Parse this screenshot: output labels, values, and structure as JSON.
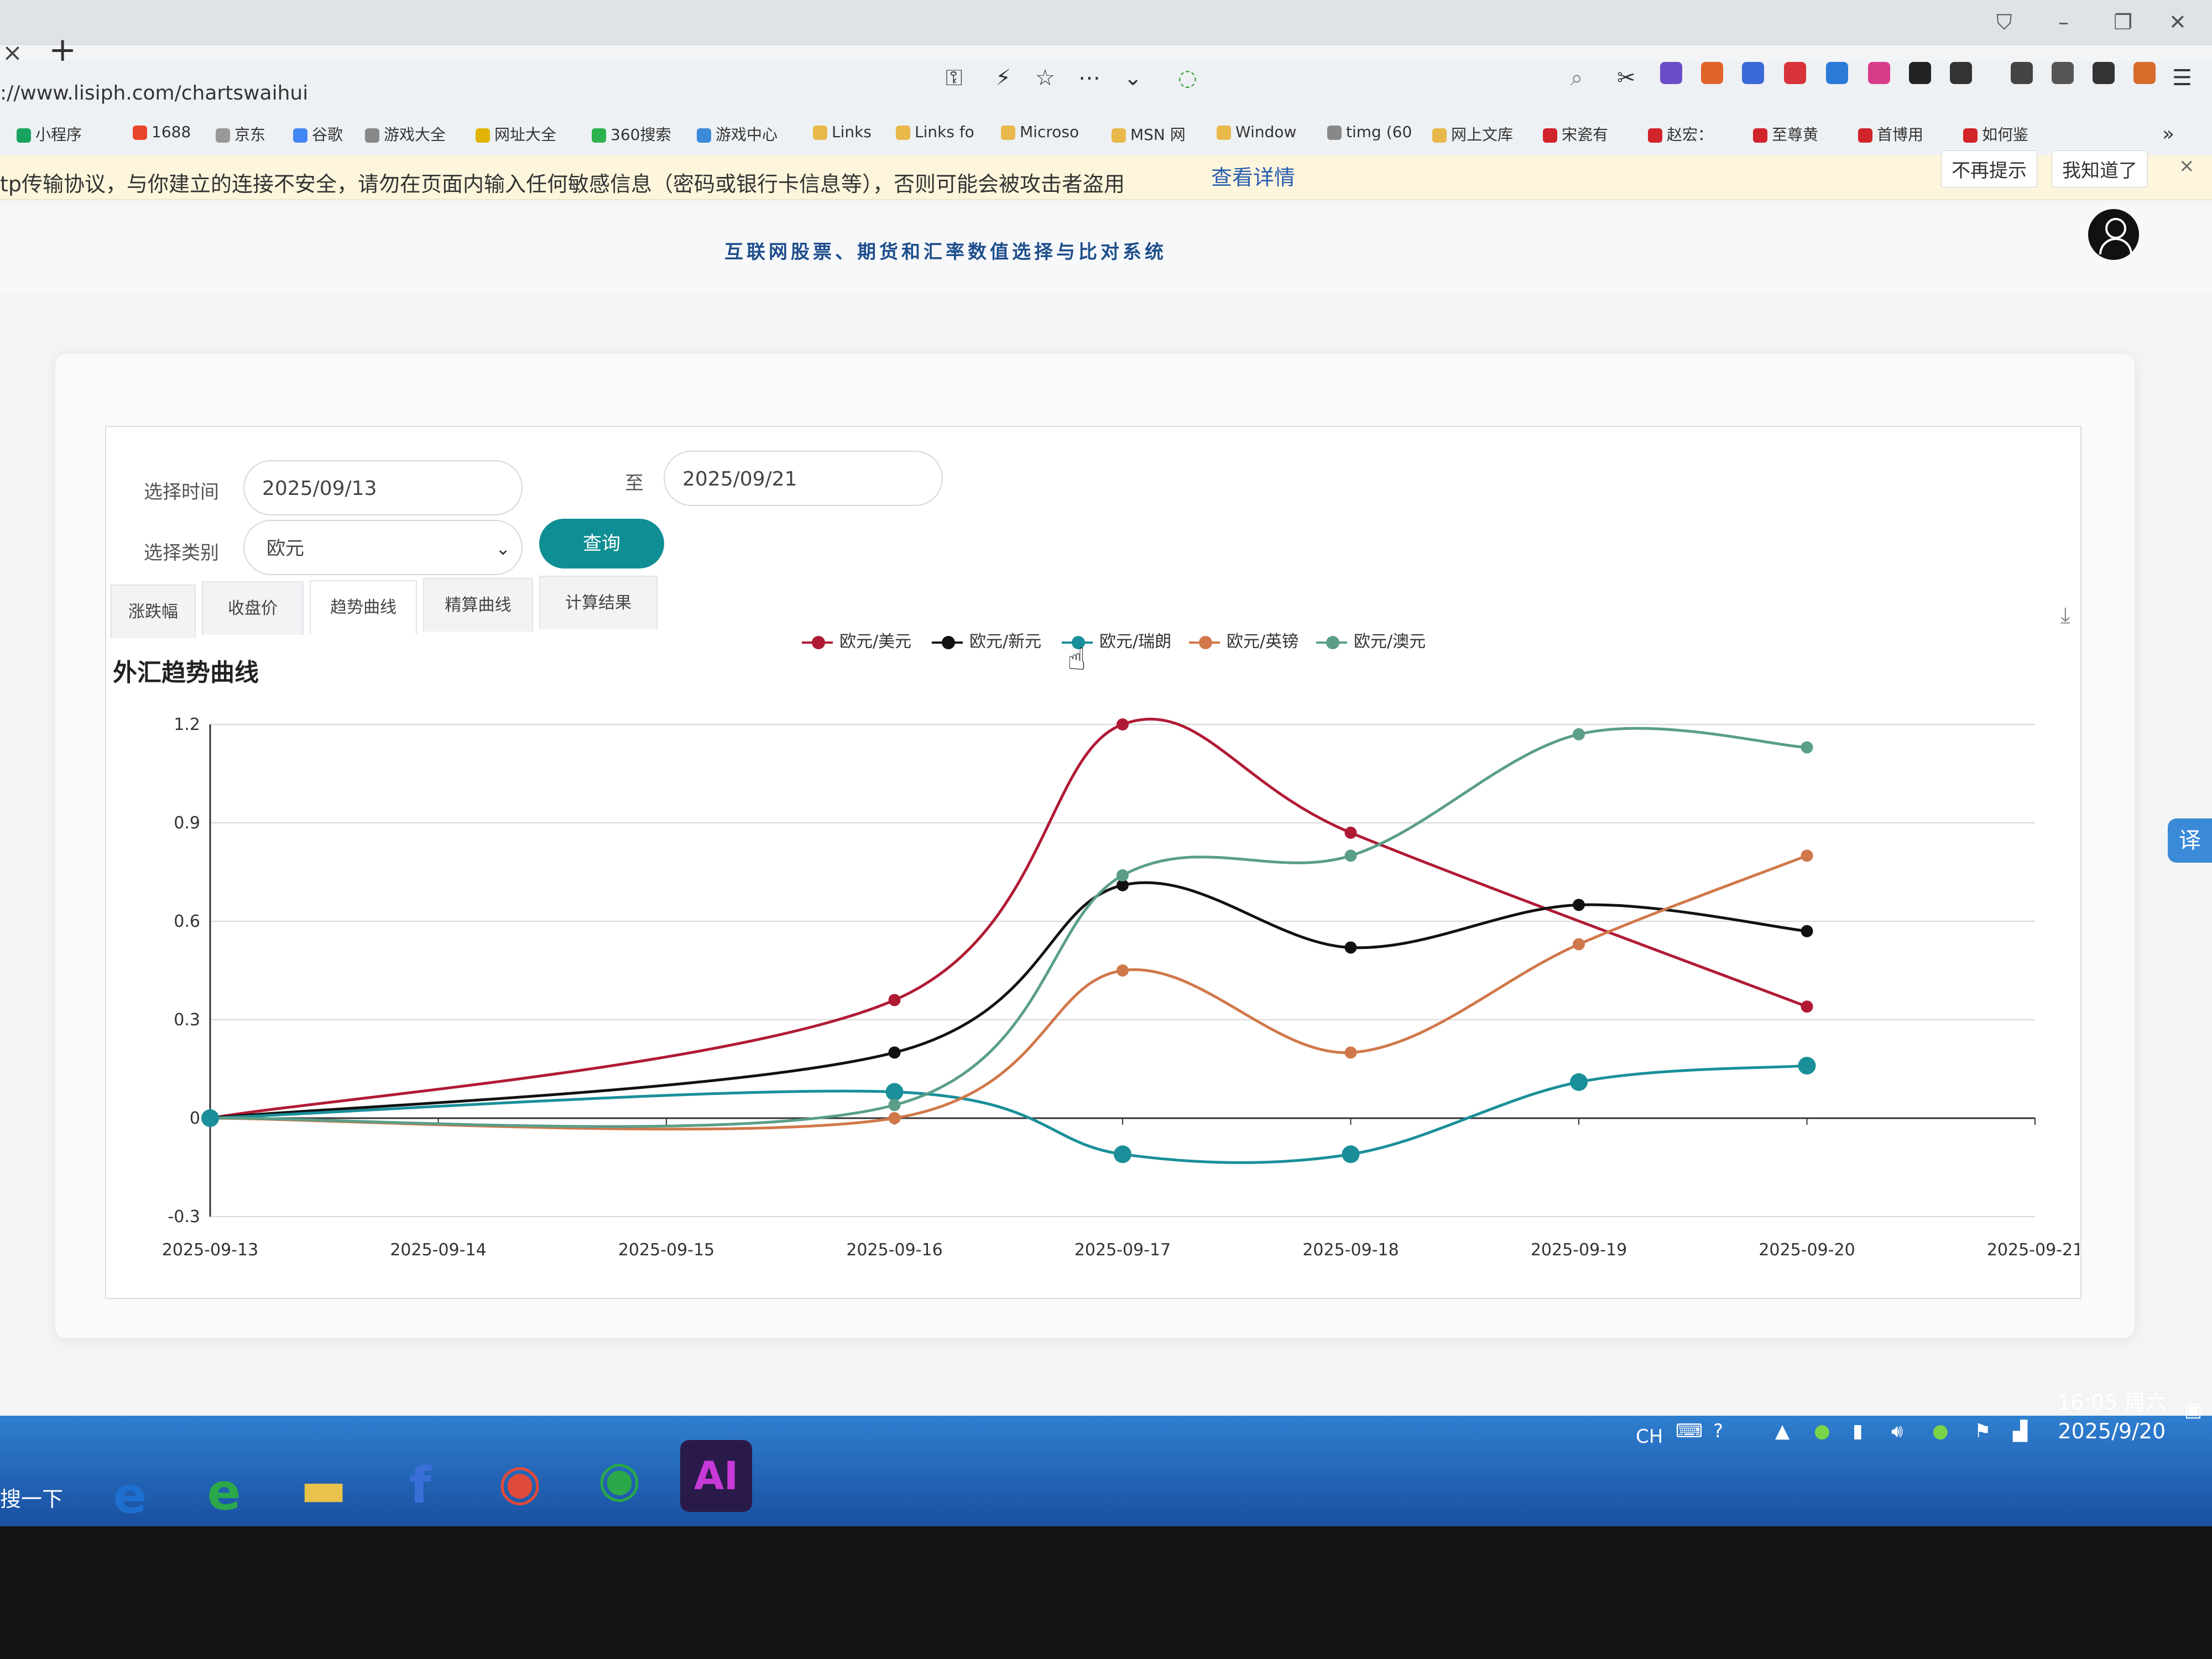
{
  "browser": {
    "tab_close": "×",
    "tab_new": "+",
    "url": "://www.lisiph.com/chartswaihui",
    "window_controls": [
      "–",
      "❐",
      "✕"
    ],
    "nav_icons": [
      "key-icon",
      "lightning-icon",
      "star-icon",
      "more-icon",
      "chevron-down-icon"
    ],
    "bookmarks": [
      {
        "label": "小程序",
        "color": "#1aa260"
      },
      {
        "label": "1688",
        "color": "#e8442c"
      },
      {
        "label": "京东",
        "color": "#999999"
      },
      {
        "label": "谷歌",
        "color": "#4285f4"
      },
      {
        "label": "游戏大全",
        "color": "#888888"
      },
      {
        "label": "网址大全",
        "color": "#e0b400"
      },
      {
        "label": "360搜索",
        "color": "#2bb24c"
      },
      {
        "label": "游戏中心",
        "color": "#3a8ad8"
      },
      {
        "label": "Links",
        "color": "#e8b84a"
      },
      {
        "label": "Links fo",
        "color": "#e8b84a"
      },
      {
        "label": "Microso",
        "color": "#e8b84a"
      },
      {
        "label": "MSN 网",
        "color": "#e8b84a"
      },
      {
        "label": "Window",
        "color": "#e8b84a"
      },
      {
        "label": "timg (60",
        "color": "#888888"
      },
      {
        "label": "网上文库",
        "color": "#e8b84a"
      },
      {
        "label": "宋瓷有",
        "color": "#d0232a"
      },
      {
        "label": "赵宏：",
        "color": "#d0232a"
      },
      {
        "label": "至尊黄",
        "color": "#d0232a"
      },
      {
        "label": "首博用",
        "color": "#d0232a"
      },
      {
        "label": "如何鉴",
        "color": "#d0232a"
      }
    ],
    "warning_text": "tp传输协议，与你建立的连接不安全，请勿在页面内输入任何敏感信息（密码或银行卡信息等），否则可能会被攻击者盗用",
    "warning_link": "查看详情",
    "warning_btn_no_remind": "不再提示",
    "warning_btn_ok": "我知道了",
    "warning_close": "×"
  },
  "page": {
    "site_title": "互联网股票、期货和汇率数值选择与比对系统"
  },
  "form": {
    "time_label": "选择时间",
    "date_from": "2025/09/13",
    "to_label": "至",
    "date_to": "2025/09/21",
    "category_label": "选择类别",
    "category_value": "欧元",
    "query_button": "查询",
    "tabs": [
      "涨跌幅",
      "收盘价",
      "趋势曲线",
      "精算曲线",
      "计算结果"
    ]
  },
  "chart_title": "外汇趋势曲线",
  "chart_data": {
    "type": "line",
    "title": "外汇趋势曲线",
    "x": [
      "2025-09-13",
      "2025-09-14",
      "2025-09-15",
      "2025-09-16",
      "2025-09-17",
      "2025-09-18",
      "2025-09-19",
      "2025-09-20",
      "2025-09-21"
    ],
    "ylim": [
      -0.3,
      1.2
    ],
    "yticks": [
      "1.2",
      "0.9",
      "0.6",
      "0.3",
      "0",
      "-0.3"
    ],
    "legend_position": "top",
    "grid": true,
    "series": [
      {
        "name": "欧元/美元",
        "color": "#b01a35",
        "points": [
          [
            0,
            0
          ],
          [
            3,
            0.36
          ],
          [
            4,
            1.2
          ],
          [
            5,
            0.87
          ],
          [
            7,
            0.34
          ]
        ]
      },
      {
        "name": "欧元/新元",
        "color": "#111111",
        "points": [
          [
            0,
            0
          ],
          [
            3,
            0.2
          ],
          [
            4,
            0.71
          ],
          [
            5,
            0.52
          ],
          [
            6,
            0.65
          ],
          [
            7,
            0.57
          ]
        ]
      },
      {
        "name": "欧元/瑞朗",
        "color": "#1a8f99",
        "points": [
          [
            0,
            0
          ],
          [
            3,
            0.08
          ],
          [
            4,
            -0.11
          ],
          [
            5,
            -0.11
          ],
          [
            6,
            0.11
          ],
          [
            7,
            0.16
          ]
        ]
      },
      {
        "name": "欧元/英镑",
        "color": "#d0784a",
        "points": [
          [
            0,
            0
          ],
          [
            3,
            0
          ],
          [
            4,
            0.45
          ],
          [
            5,
            0.2
          ],
          [
            6,
            0.53
          ],
          [
            7,
            0.8
          ]
        ]
      },
      {
        "name": "欧元/澳元",
        "color": "#5a9e88",
        "points": [
          [
            0,
            0
          ],
          [
            3,
            0.04
          ],
          [
            4,
            0.74
          ],
          [
            5,
            0.8
          ],
          [
            6,
            1.17
          ],
          [
            7,
            1.13
          ]
        ]
      }
    ]
  },
  "taskbar": {
    "start_label": "搜一下",
    "apps": [
      {
        "name": "ie-icon",
        "glyph": "e",
        "color": "#1e6fd0"
      },
      {
        "name": "ie-green-icon",
        "glyph": "e",
        "color": "#2aa84a"
      },
      {
        "name": "folder-icon",
        "glyph": "▬",
        "color": "#e8c24a"
      },
      {
        "name": "flash-icon",
        "glyph": "f",
        "color": "#3b6fd8"
      },
      {
        "name": "chrome-icon",
        "glyph": "◉",
        "color": "#e04a3a"
      },
      {
        "name": "chrome-alt-icon",
        "glyph": "◉",
        "color": "#2aa84a"
      },
      {
        "name": "ai-icon",
        "glyph": "AI",
        "color": "#c83ad8"
      }
    ],
    "tray_lang": "CH",
    "clock_time": "16:05 周六",
    "clock_date": "2025/9/20"
  }
}
